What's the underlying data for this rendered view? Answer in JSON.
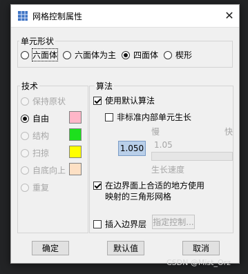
{
  "dialog": {
    "title": "网格控制属性",
    "close_glyph": "✕"
  },
  "element_shape": {
    "label": "单元形状",
    "options": [
      {
        "label": "六面体",
        "selected": false
      },
      {
        "label": "六面体为主",
        "selected": false
      },
      {
        "label": "四面体",
        "selected": true
      },
      {
        "label": "楔形",
        "selected": false
      }
    ]
  },
  "technique": {
    "label": "技术",
    "options": [
      {
        "label": "保持原状",
        "selected": false,
        "enabled": false,
        "color": null
      },
      {
        "label": "自由",
        "selected": true,
        "enabled": true,
        "color": "#ffb6c8"
      },
      {
        "label": "结构",
        "selected": false,
        "enabled": false,
        "color": "#1de01d"
      },
      {
        "label": "扫掠",
        "selected": false,
        "enabled": false,
        "color": "#ffff00"
      },
      {
        "label": "自底向上",
        "selected": false,
        "enabled": false,
        "color": "#fde0c4"
      },
      {
        "label": "重复",
        "selected": false,
        "enabled": false,
        "color": null
      }
    ]
  },
  "algorithm": {
    "label": "算法",
    "use_default": {
      "label": "使用默认算法",
      "checked": true
    },
    "non_standard": {
      "label": "非标准内部单元生长",
      "checked": false
    },
    "slow_label": "慢",
    "fast_label": "快",
    "growth_value": "1.050",
    "slider_value": "1.05",
    "growth_label": "生长速度",
    "boundary_mapping": {
      "label_line1": "在边界面上合适的地方使用",
      "label_line2": "映射的三角形网格",
      "checked": true
    },
    "insert_boundary": {
      "label": "插入边界层",
      "checked": false
    },
    "assign_controls_label": "指定控制..."
  },
  "buttons": {
    "ok": "确定",
    "defaults": "默认值",
    "cancel": "取消"
  },
  "watermark": "CSDN @Mist_Orz"
}
